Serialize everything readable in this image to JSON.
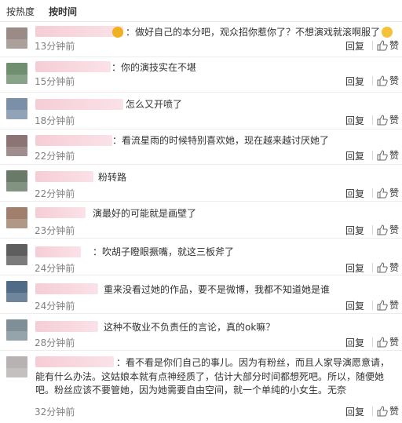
{
  "sort": {
    "hot": "按热度",
    "time": "按时间"
  },
  "actions": {
    "reply": "回复",
    "like": "赞"
  },
  "comments": [
    {
      "text": "：做好自己的本分吧，观众招你惹你了？不想演戏就滚啊服了",
      "time": "13分钟前",
      "avatar_color": "#9a8b86"
    },
    {
      "text": "：你的演技实在不堪",
      "time": "15分钟前",
      "avatar_color": "#6f8f70"
    },
    {
      "text": "怎么又开喷了",
      "time": "18分钟前",
      "avatar_color": "#7c8fa8"
    },
    {
      "text": "：看流星雨的时候特别喜欢她，现在越来越讨厌她了",
      "time": "22分钟前",
      "avatar_color": "#8c7474"
    },
    {
      "text": "粉转路",
      "time": "22分钟前",
      "avatar_color": "#6a7a68"
    },
    {
      "text": "演最好的可能就是画壁了",
      "time": "23分钟前",
      "avatar_color": "#a0806c"
    },
    {
      "text": "：吹胡子瞪眼撅嘴，就这三板斧了",
      "time": "24分钟前",
      "avatar_color": "#5e5e5e"
    },
    {
      "text": "重来没看过她的作品，要不是微博，我都不知道她是谁",
      "time": "24分钟前",
      "avatar_color": "#4f6b86"
    },
    {
      "text": "这种不敬业不负责任的言论，真的ok嘛？",
      "time": "28分钟前",
      "avatar_color": "#7e8f98"
    },
    {
      "text": "：看不看是你们自己的事儿。因为有粉丝，而且人家导演愿意请，能有什么办法。这姑娘本就有点神经质了，估计大部分时间都想死吧。所以，随便她吧。粉丝应该不要管她，因为她需要自由空间，就一个单纯的小女生。无奈",
      "time": "32分钟前",
      "avatar_color": "#b9b2b2"
    }
  ]
}
